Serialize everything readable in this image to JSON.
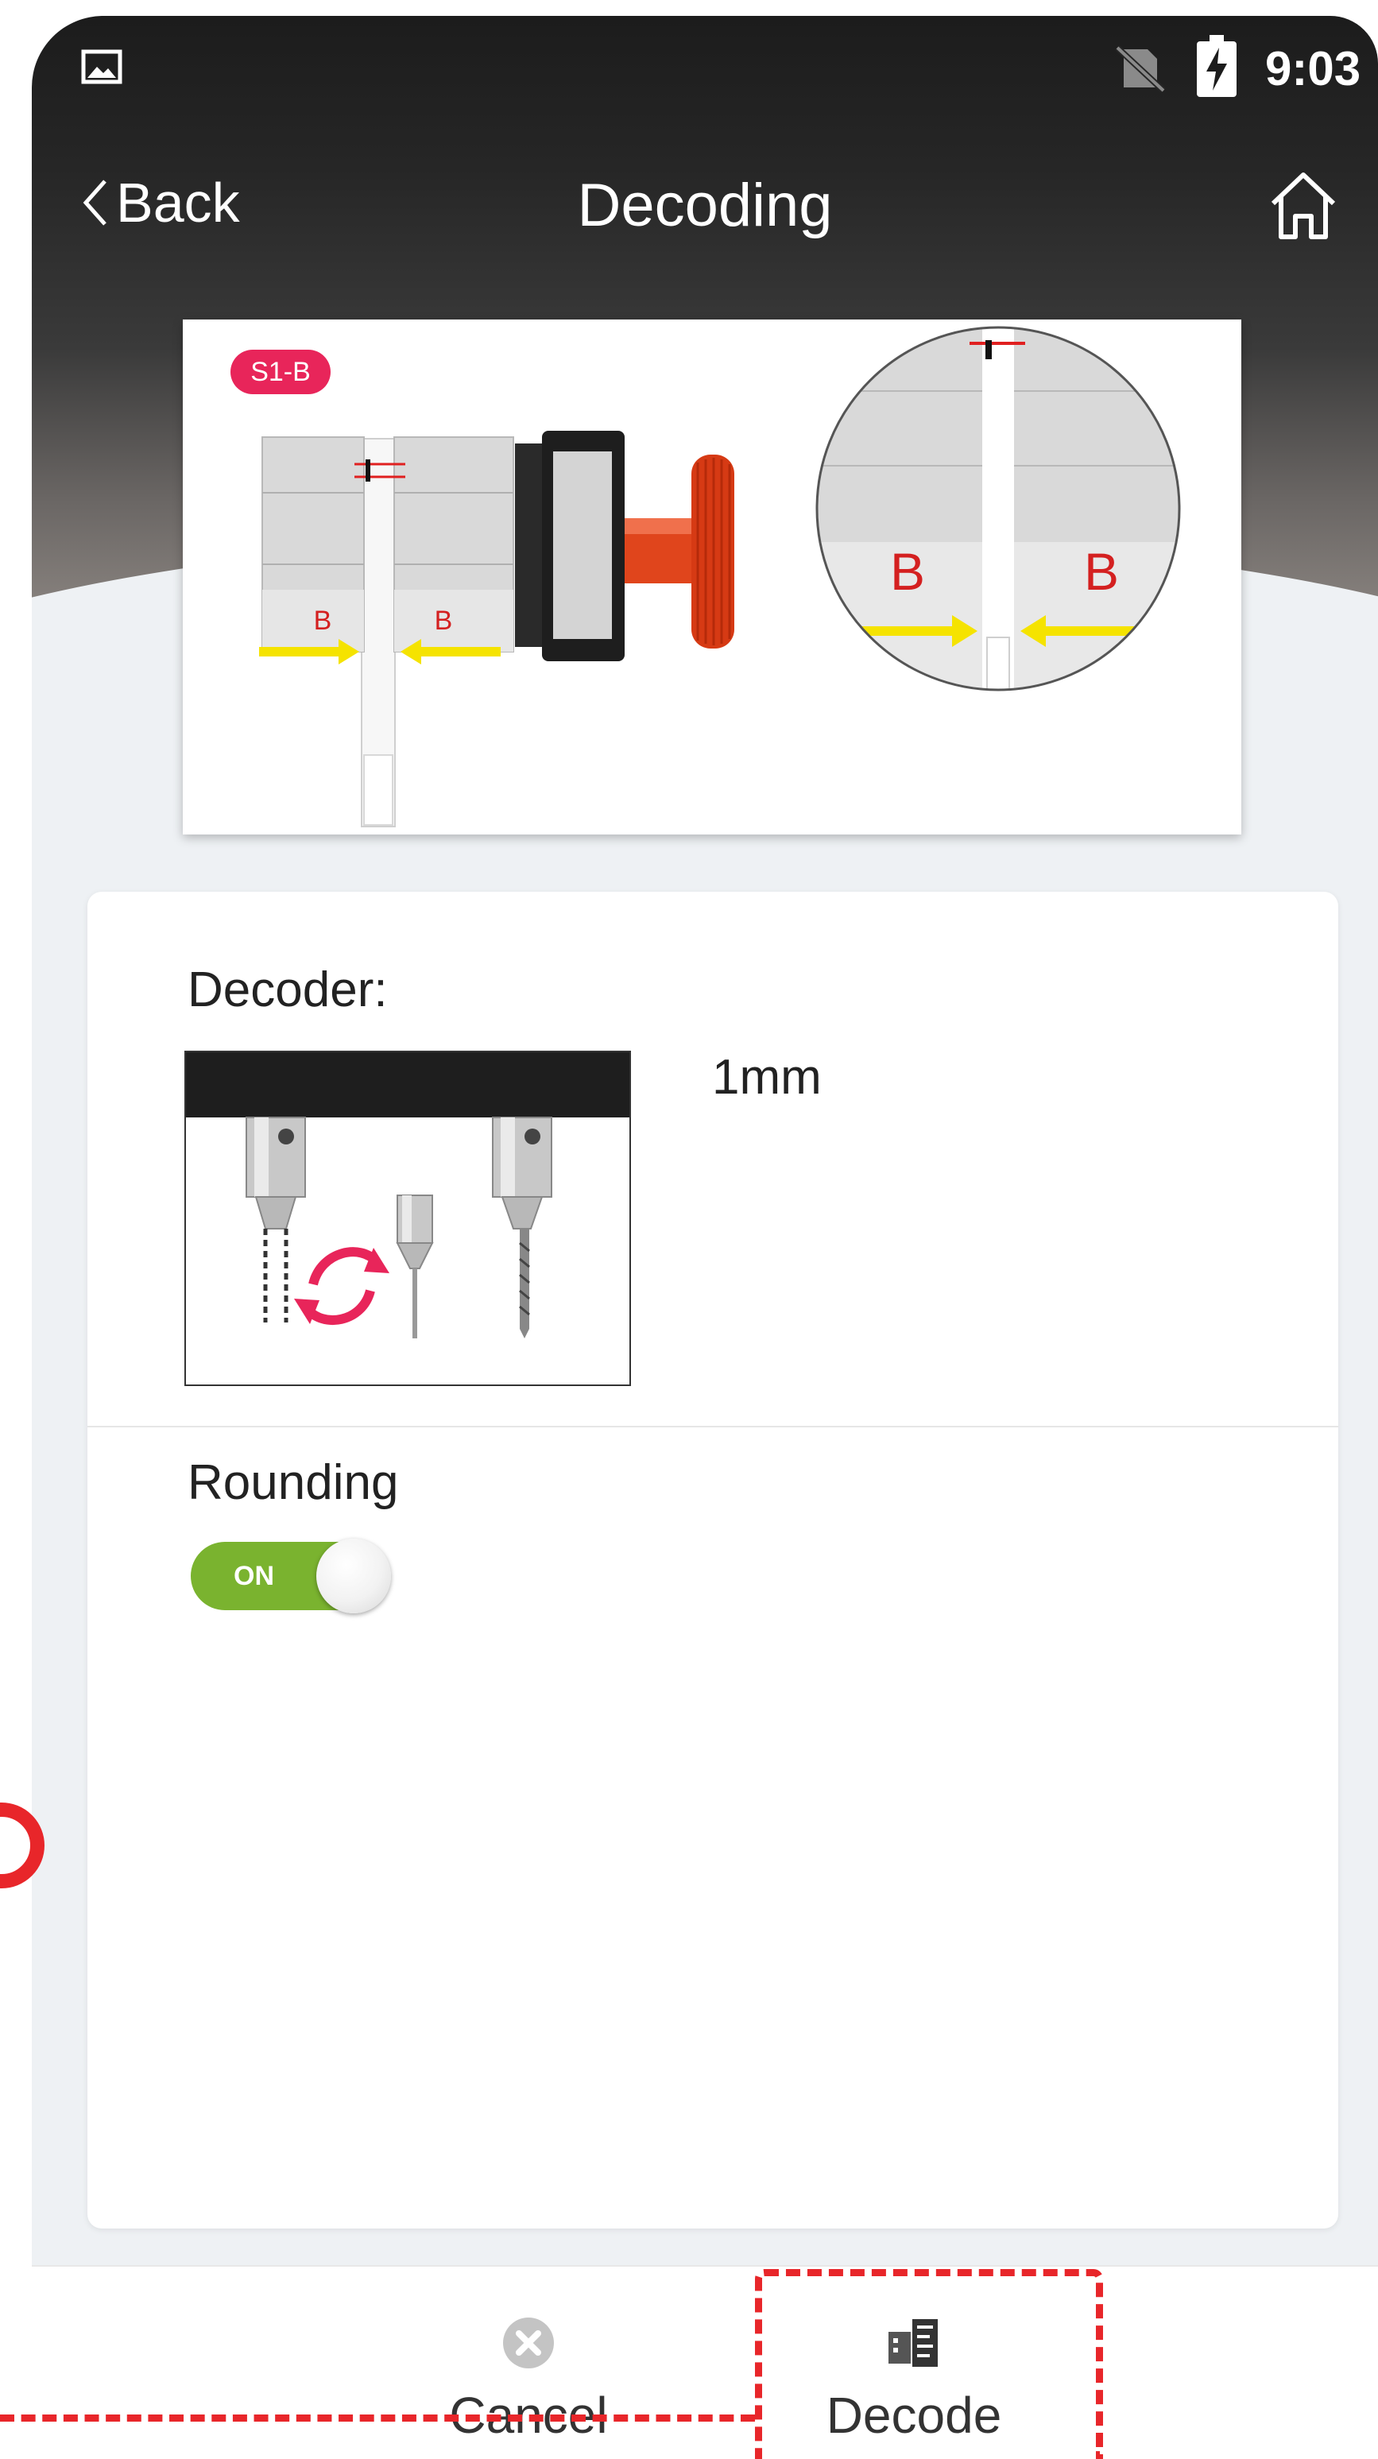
{
  "status_bar": {
    "time": "9:03"
  },
  "nav": {
    "back_label": "Back",
    "title": "Decoding"
  },
  "hero_image": {
    "badge": "S1-B",
    "left_marks": [
      "B",
      "B"
    ],
    "zoom_marks": [
      "B",
      "B"
    ]
  },
  "settings": {
    "decoder_label": "Decoder:",
    "decoder_size": "1mm",
    "rounding_label": "Rounding",
    "rounding_toggle_text": "ON",
    "rounding_on": true
  },
  "bottom_bar": {
    "cancel_label": "Cancel",
    "decode_label": "Decode"
  },
  "colors": {
    "accent_red": "#e8262a",
    "toggle_green": "#7ab32f",
    "badge_pink": "#e8255a",
    "arrow_yellow": "#f5e300",
    "knob_orange": "#e0451c"
  }
}
